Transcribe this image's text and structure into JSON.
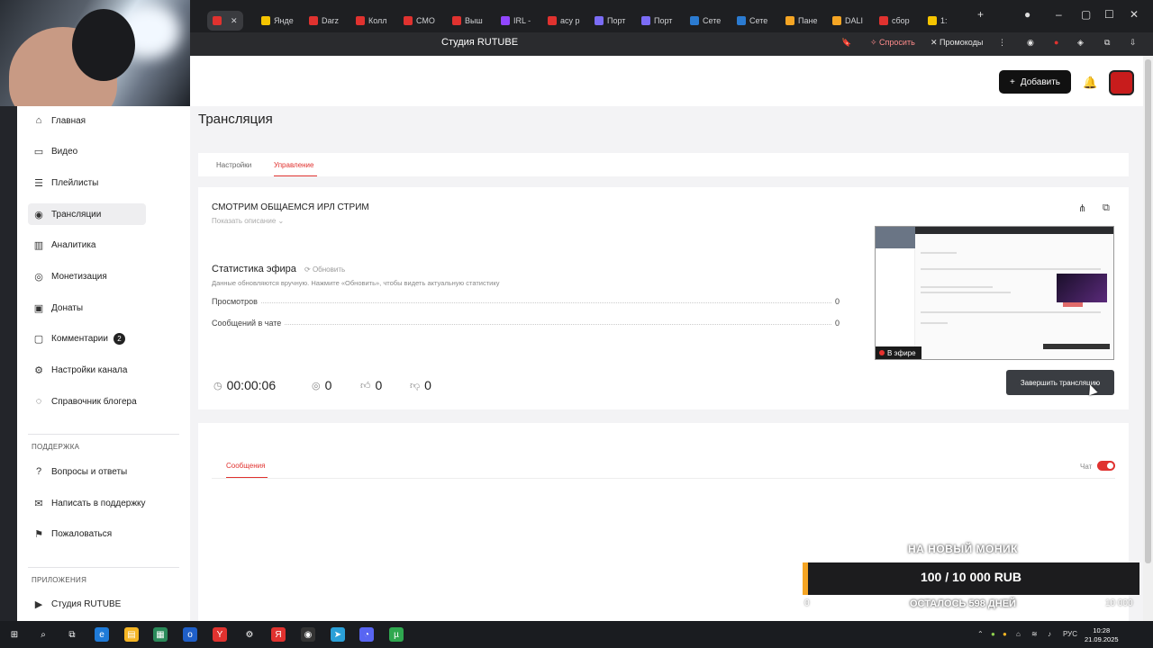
{
  "browser": {
    "tabs": [
      {
        "label": "",
        "color": "#e0322f"
      },
      {
        "label": "Янде",
        "color": "#f5c400"
      },
      {
        "label": "Darz",
        "color": "#e0322f"
      },
      {
        "label": "Колл",
        "color": "#e0322f"
      },
      {
        "label": "СМО",
        "color": "#e0322f"
      },
      {
        "label": "Выш",
        "color": "#e0322f"
      },
      {
        "label": "IRL -",
        "color": "#9146ff"
      },
      {
        "label": "асу р",
        "color": "#e0322f"
      },
      {
        "label": "Порт",
        "color": "#7b6cf6"
      },
      {
        "label": "Порт",
        "color": "#7b6cf6"
      },
      {
        "label": "Сете",
        "color": "#2b7bd1"
      },
      {
        "label": "Сете",
        "color": "#2b7bd1"
      },
      {
        "label": "Пане",
        "color": "#f5a524"
      },
      {
        "label": "DALI",
        "color": "#f5a524"
      },
      {
        "label": "сбор",
        "color": "#e0322f"
      },
      {
        "label": "1:",
        "color": "#f5c400"
      }
    ],
    "page_title": "Студия RUTUBE",
    "ask_label": "Спросить",
    "promo_label": "Промокоды"
  },
  "sidebar": {
    "items": [
      {
        "label": "Главная",
        "icon": "home-icon"
      },
      {
        "label": "Видео",
        "icon": "video-icon"
      },
      {
        "label": "Плейлисты",
        "icon": "playlist-icon"
      },
      {
        "label": "Трансляции",
        "icon": "broadcast-icon"
      },
      {
        "label": "Аналитика",
        "icon": "chart-icon"
      },
      {
        "label": "Монетизация",
        "icon": "coin-icon"
      },
      {
        "label": "Донаты",
        "icon": "donate-icon"
      },
      {
        "label": "Комментарии",
        "icon": "comment-icon",
        "badge": "2"
      },
      {
        "label": "Настройки канала",
        "icon": "gear-icon"
      },
      {
        "label": "Справочник блогера",
        "icon": "help-icon"
      }
    ],
    "support_label": "ПОДДЕРЖКА",
    "support_items": [
      {
        "label": "Вопросы и ответы",
        "icon": "question-icon"
      },
      {
        "label": "Написать в поддержку",
        "icon": "mail-icon"
      },
      {
        "label": "Пожаловаться",
        "icon": "flag-icon"
      }
    ],
    "apps_label": "ПРИЛОЖЕНИЯ",
    "apps_items": [
      {
        "label": "Студия RUTUBE",
        "icon": "studio-icon"
      }
    ]
  },
  "header": {
    "add_label": "Добавить"
  },
  "main": {
    "title": "Трансляция",
    "tabs": [
      "Настройки",
      "Управление"
    ],
    "stream_title": "СМОТРИМ ОБЩАЕМСЯ ИРЛ СТРИМ",
    "show_description": "Показать описание",
    "stats_title": "Статистика эфира",
    "refresh_label": "Обновить",
    "stats_note": "Данные обновляются вручную. Нажмите «Обновить», чтобы видеть актуальную статистику",
    "stats": [
      {
        "label": "Просмотров",
        "value": "0"
      },
      {
        "label": "Сообщений в чате",
        "value": "0"
      }
    ],
    "duration": "00:00:06",
    "viewers": "0",
    "likes": "0",
    "dislikes": "0",
    "live_label": "В эфире",
    "end_button": "Завершить трансляцию",
    "chat_tab": "Сообщения",
    "chat_toggle_label": "Чат"
  },
  "donation": {
    "goal_title": "НА НОВЫЙ МОНИК",
    "amount": "100 / 10 000 RUB",
    "days_left": "ОСТАЛОСЬ 598 ДНЕЙ",
    "min": "0",
    "max": "10 000"
  },
  "taskbar": {
    "lang": "РУС",
    "time": "10:28",
    "date": "21.09.2025"
  },
  "colors": {
    "accent": "#e0322f",
    "donation_bar": "#f5a524"
  }
}
